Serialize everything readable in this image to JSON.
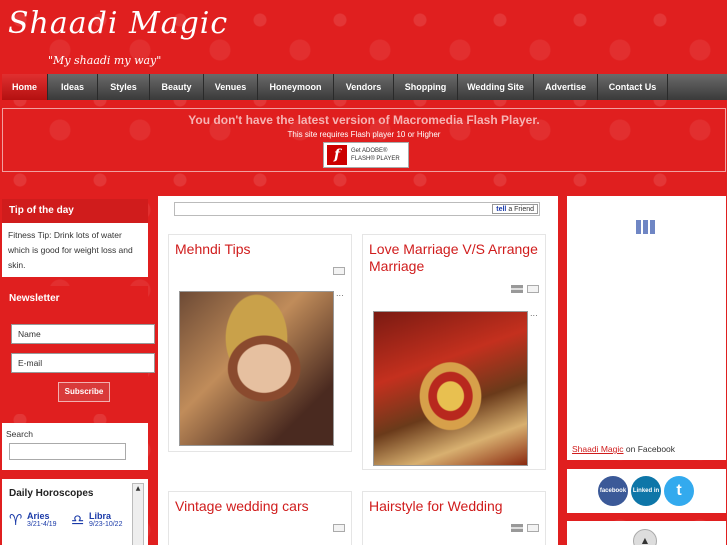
{
  "header": {
    "logo": "Shaadi Magic",
    "tagline": "\"My shaadi my way\""
  },
  "nav": {
    "items": [
      {
        "label": "Home",
        "active": true
      },
      {
        "label": "Ideas",
        "active": false
      },
      {
        "label": "Styles",
        "active": false
      },
      {
        "label": "Beauty",
        "active": false
      },
      {
        "label": "Venues",
        "active": false
      },
      {
        "label": "Honeymoon",
        "active": false
      },
      {
        "label": "Vendors",
        "active": false
      },
      {
        "label": "Shopping",
        "active": false
      },
      {
        "label": "Wedding Site",
        "active": false
      },
      {
        "label": "Advertise",
        "active": false
      },
      {
        "label": "Contact Us",
        "active": false
      }
    ]
  },
  "flash": {
    "title": "You don't have the latest version of Macromedia Flash Player.",
    "subtitle": "This site requires Flash player 10 or Higher",
    "button_line1": "Get ADOBE®",
    "button_line2": "FLASH® PLAYER",
    "logo_glyph": "f"
  },
  "tip": {
    "heading": "Tip of the day",
    "text": "Fitness Tip: Drink lots of water which is good for weight loss and skin."
  },
  "newsletter": {
    "heading": "Newsletter",
    "name_placeholder": "Name",
    "email_placeholder": "E-mail",
    "subscribe_label": "Subscribe"
  },
  "search": {
    "label": "Search",
    "value": ""
  },
  "horoscopes": {
    "heading": "Daily Horoscopes",
    "signs": [
      {
        "glyph": "♈",
        "name": "Aries",
        "dates": "3/21-4/19"
      },
      {
        "glyph": "♎",
        "name": "Libra",
        "dates": "9/23-10/22"
      }
    ]
  },
  "share": {
    "tell_prefix": "tell",
    "tell_suffix": "a Friend"
  },
  "articles": [
    {
      "title": "Mehndi Tips",
      "ellipsis": "..."
    },
    {
      "title": "Love Marriage V/S Arrange Marriage",
      "ellipsis": "..."
    },
    {
      "title": "Vintage wedding cars"
    },
    {
      "title": "Hairstyle for Wedding"
    }
  ],
  "facebook": {
    "link_text": "Shaadi Magic",
    "suffix": " on Facebook"
  },
  "social": {
    "facebook": "facebook",
    "linkedin": "Linked in",
    "twitter": "t"
  },
  "colors": {
    "background_red": "#e01f1f",
    "accent_red": "#d01c1c",
    "nav_dark": "#3a3a3a",
    "facebook_blue": "#3b5998",
    "linkedin_blue": "#0e76a8",
    "twitter_blue": "#33aaee"
  }
}
